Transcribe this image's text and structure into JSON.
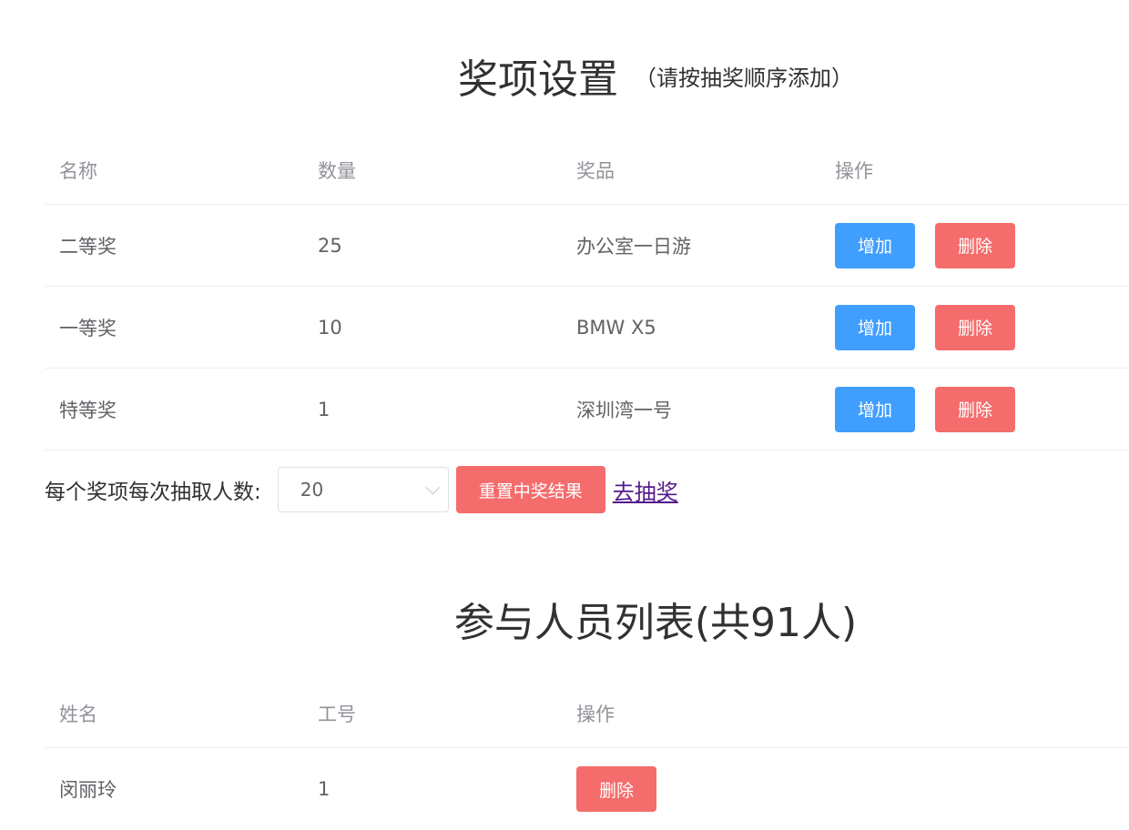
{
  "prizes": {
    "title": "奖项设置",
    "note": "（请按抽奖顺序添加）",
    "columns": [
      "名称",
      "数量",
      "奖品",
      "操作"
    ],
    "rows": [
      {
        "name": "二等奖",
        "count": "25",
        "prize": "办公室一日游"
      },
      {
        "name": "一等奖",
        "count": "10",
        "prize": "BMW X5"
      },
      {
        "name": "特等奖",
        "count": "1",
        "prize": "深圳湾一号"
      }
    ],
    "add_label": "增加",
    "delete_label": "删除"
  },
  "controls": {
    "draw_count_label": "每个奖项每次抽取人数:",
    "draw_count_value": "20",
    "reset_label": "重置中奖结果",
    "go_draw_label": "去抽奖"
  },
  "participants": {
    "title": "参与人员列表(共91人)",
    "columns": [
      "姓名",
      "工号",
      "操作"
    ],
    "rows": [
      {
        "name": "闵丽玲",
        "id": "1"
      }
    ],
    "delete_label": "删除"
  },
  "colors": {
    "primary": "#409eff",
    "danger": "#f56c6c",
    "link": "#551a8b"
  }
}
